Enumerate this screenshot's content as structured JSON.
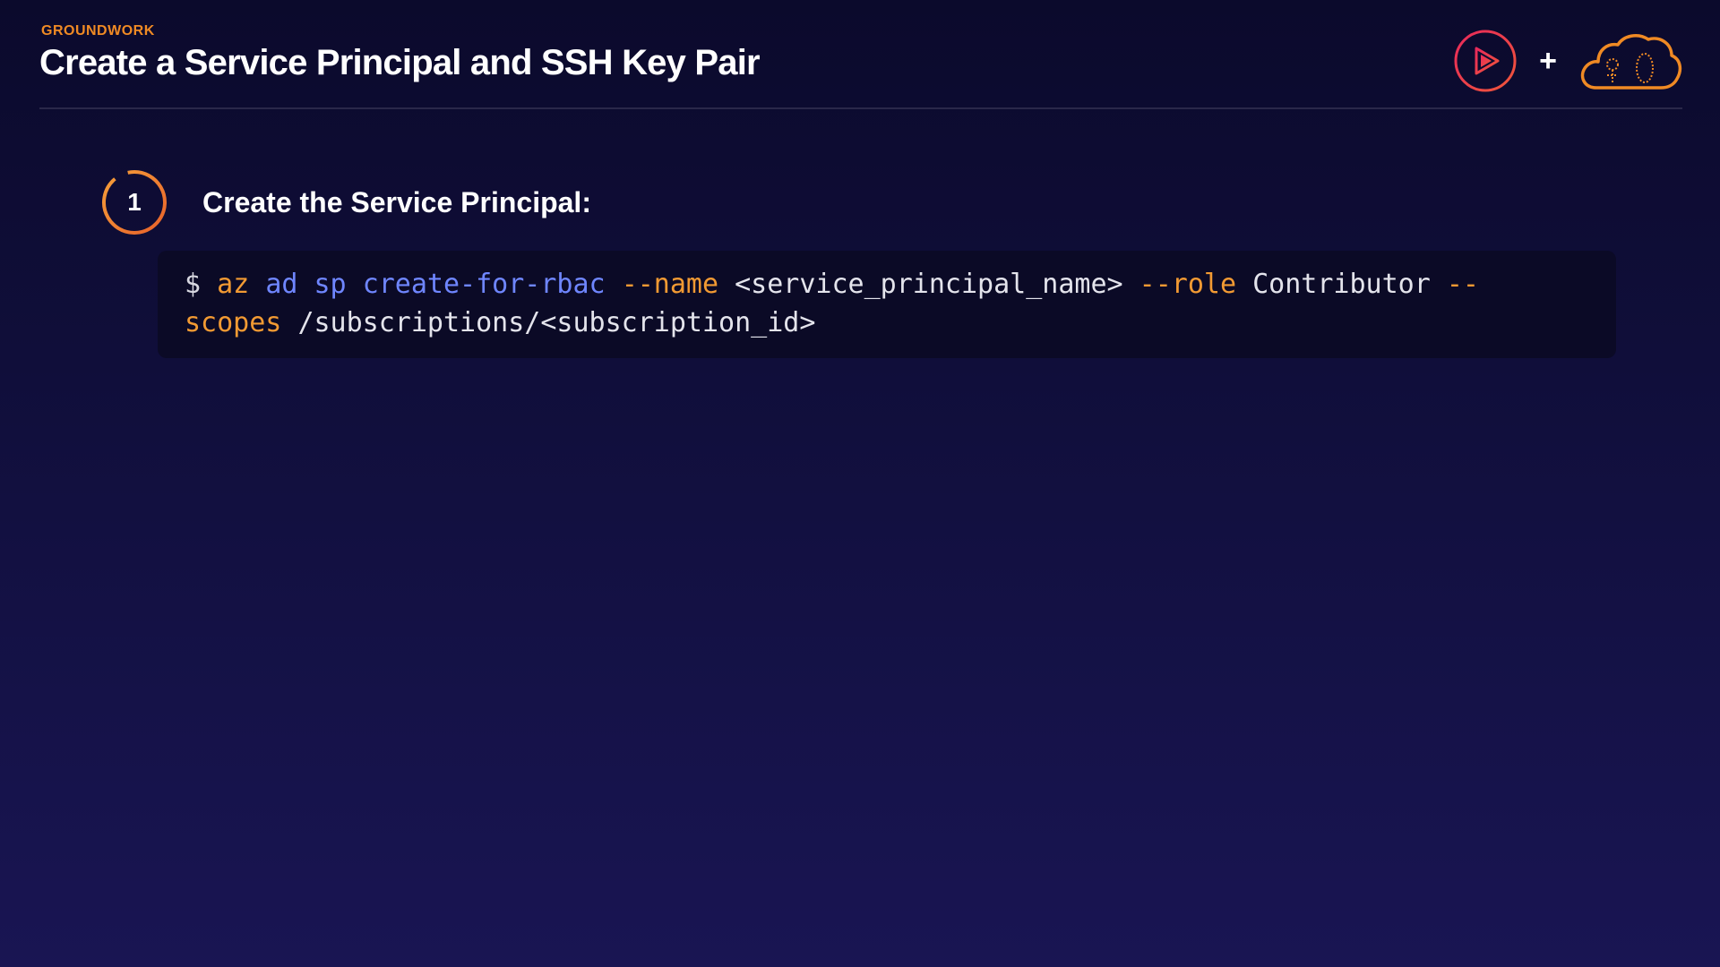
{
  "header": {
    "eyebrow": "GROUNDWORK",
    "title": "Create a Service Principal and SSH Key Pair",
    "plus": "+"
  },
  "logos": {
    "left_icon": "pluralsight-play-icon",
    "right_icon": "cloud-logo-icon"
  },
  "step": {
    "number": "1",
    "label": "Create the Service Principal:"
  },
  "code": {
    "line1": {
      "prompt": "$",
      "az": "az",
      "ad": "ad",
      "sp": "sp",
      "cmd": "create-for-rbac",
      "name_flag": "--name",
      "name_value": "<service_principal_name>",
      "role_flag": "--role",
      "role_value": "Contributor",
      "scopes_flag_part1": "--"
    },
    "line2": {
      "scopes_flag_part2": "scopes",
      "scopes_value": "/subscriptions/<subscription_id>"
    }
  },
  "colors": {
    "accent_orange": "#f08a24",
    "code_blue": "#6f86ff",
    "logo_red": "#e8295b",
    "background_top": "#0b0a2c",
    "background_bottom": "#191553"
  }
}
